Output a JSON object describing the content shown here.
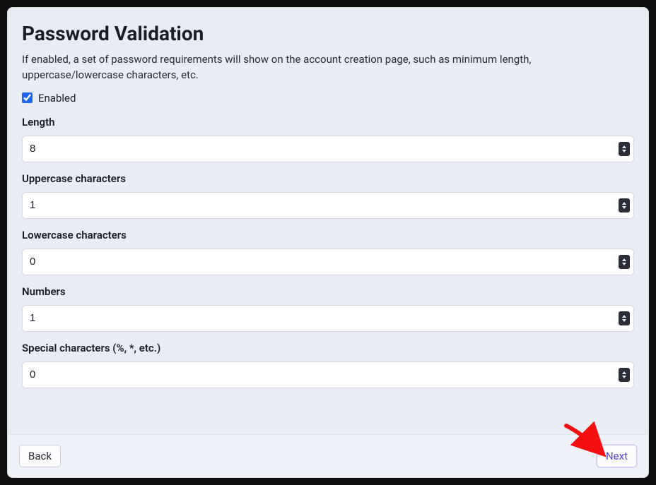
{
  "header": {
    "title": "Password Validation",
    "description": "If enabled, a set of password requirements will show on the account creation page, such as minimum length, uppercase/lowercase characters, etc."
  },
  "enabled": {
    "label": "Enabled",
    "checked": true
  },
  "fields": {
    "length": {
      "label": "Length",
      "value": "8"
    },
    "uppercase": {
      "label": "Uppercase characters",
      "value": "1"
    },
    "lowercase": {
      "label": "Lowercase characters",
      "value": "0"
    },
    "numbers": {
      "label": "Numbers",
      "value": "1"
    },
    "special": {
      "label": "Special characters (%, *, etc.)",
      "value": "0"
    }
  },
  "footer": {
    "back": "Back",
    "next": "Next"
  }
}
